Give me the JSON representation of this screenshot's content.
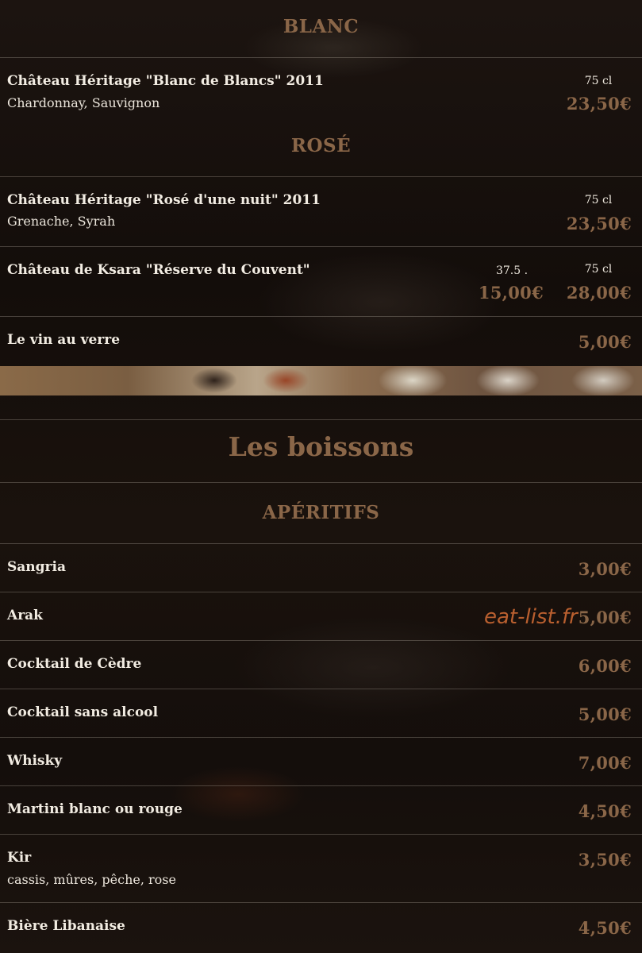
{
  "sections": {
    "blanc": "BLANC",
    "rose": "ROSÉ",
    "boissons": "Les boissons",
    "aperitifs": "APÉRITIFS"
  },
  "wines": [
    {
      "name": "Château Héritage \"Blanc de Blancs\" 2011",
      "desc": "Chardonnay, Sauvignon",
      "volume": "75 cl",
      "price": "23,50€"
    },
    {
      "name": "Château Héritage \"Rosé d'une nuit\" 2011",
      "desc": "Grenache, Syrah",
      "volume": "75 cl",
      "price": "23,50€"
    },
    {
      "name": "Château de Ksara \"Réserve du Couvent\"",
      "volume_small": "37.5 .",
      "price_small": "15,00€",
      "volume": "75 cl",
      "price": "28,00€"
    },
    {
      "name": "Le vin au verre",
      "price": "5,00€"
    }
  ],
  "aperitifs": [
    {
      "name": "Sangria",
      "price": "3,00€"
    },
    {
      "name": "Arak",
      "price": "5,00€"
    },
    {
      "name": "Cocktail de Cèdre",
      "price": "6,00€"
    },
    {
      "name": "Cocktail sans alcool",
      "price": "5,00€"
    },
    {
      "name": "Whisky",
      "price": "7,00€"
    },
    {
      "name": "Martini blanc ou rouge",
      "price": "4,50€"
    },
    {
      "name": "Kir",
      "desc": "cassis, mûres, pêche, rose",
      "price": "3,50€"
    },
    {
      "name": "Bière Libanaise",
      "price": "4,50€"
    }
  ],
  "watermark": "eat-list.fr",
  "colors": {
    "accent": "#8a6648",
    "watermark": "#b95f2f",
    "text": "#f2ece2"
  }
}
